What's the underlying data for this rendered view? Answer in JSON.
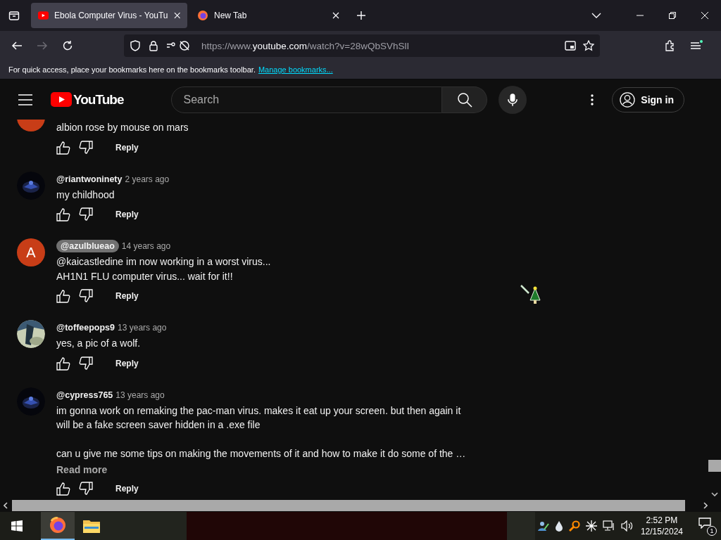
{
  "browser": {
    "tabs": [
      {
        "title": "Ebola Computer Virus - YouTu",
        "kind": "youtube",
        "selected": true
      },
      {
        "title": "New Tab",
        "kind": "firefox",
        "selected": false
      }
    ],
    "url": {
      "prefix": "https://www.",
      "domain": "youtube.com",
      "path": "/watch?v=28wQbSVhSlI"
    },
    "bookmarks_bar": {
      "text": "For quick access, place your bookmarks here on the bookmarks toolbar.",
      "link": "Manage bookmarks..."
    }
  },
  "youtube": {
    "logo": "YouTube",
    "search": {
      "placeholder": "Search"
    },
    "sign_in": "Sign in",
    "comments": [
      {
        "avatar": {
          "kind": "letter",
          "color": "#c83d17"
        },
        "text": "albion rose by mouse on mars",
        "reply": "Reply"
      },
      {
        "author": "@riantwoninety",
        "highlighted": false,
        "time": "2 years ago",
        "text": "my childhood",
        "reply": "Reply"
      },
      {
        "author": "@azulblueao",
        "highlighted": true,
        "time": "14 years ago",
        "avatar": {
          "kind": "letter",
          "letter": "A",
          "color": "#c83d17"
        },
        "text": "@kaicastledine im now working in a worst virus...\nAH1N1 FLU computer virus... wait for it!!",
        "reply": "Reply"
      },
      {
        "author": "@toffeepops9",
        "highlighted": false,
        "time": "13 years ago",
        "text": "yes, a pic of a wolf.",
        "reply": "Reply"
      },
      {
        "author": "@cypress765",
        "highlighted": false,
        "time": "13 years ago",
        "text": "im gonna work on remaking the pac-man virus. makes it eat up your screen. but then again it\nwill be a fake screen saver hidden in a .exe file\n\ncan u give me some tips on making the movements of it and how to make it do some of the …",
        "read_more": "Read more",
        "reply": "Reply"
      }
    ]
  },
  "taskbar": {
    "time": "2:52 PM",
    "date": "12/15/2024",
    "notifications": "1"
  }
}
